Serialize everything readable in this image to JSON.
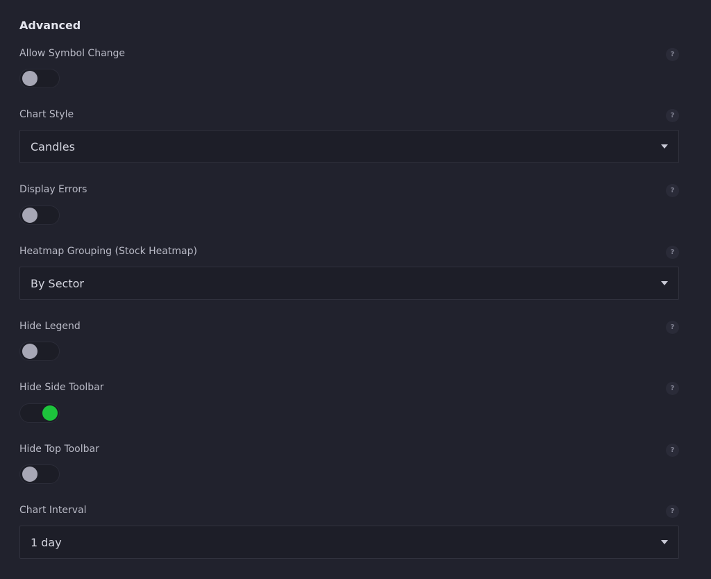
{
  "section": {
    "title": "Advanced"
  },
  "fields": [
    {
      "label": "Allow Symbol Change",
      "help_icon": "?",
      "type": "toggle",
      "on": false
    },
    {
      "label": "Chart Style",
      "help_icon": "?",
      "type": "select",
      "value": "Candles"
    },
    {
      "label": "Display Errors",
      "help_icon": "?",
      "type": "toggle",
      "on": false
    },
    {
      "label": "Heatmap Grouping (Stock Heatmap)",
      "help_icon": "?",
      "type": "select",
      "value": "By Sector"
    },
    {
      "label": "Hide Legend",
      "help_icon": "?",
      "type": "toggle",
      "on": false
    },
    {
      "label": "Hide Side Toolbar",
      "help_icon": "?",
      "type": "toggle",
      "on": true
    },
    {
      "label": "Hide Top Toolbar",
      "help_icon": "?",
      "type": "toggle",
      "on": false
    },
    {
      "label": "Chart Interval",
      "help_icon": "?",
      "type": "select",
      "value": "1 day"
    }
  ],
  "colors": {
    "background": "#21222d",
    "toggle_on": "#1dc43c",
    "toggle_off_knob": "#a7a7b5"
  }
}
